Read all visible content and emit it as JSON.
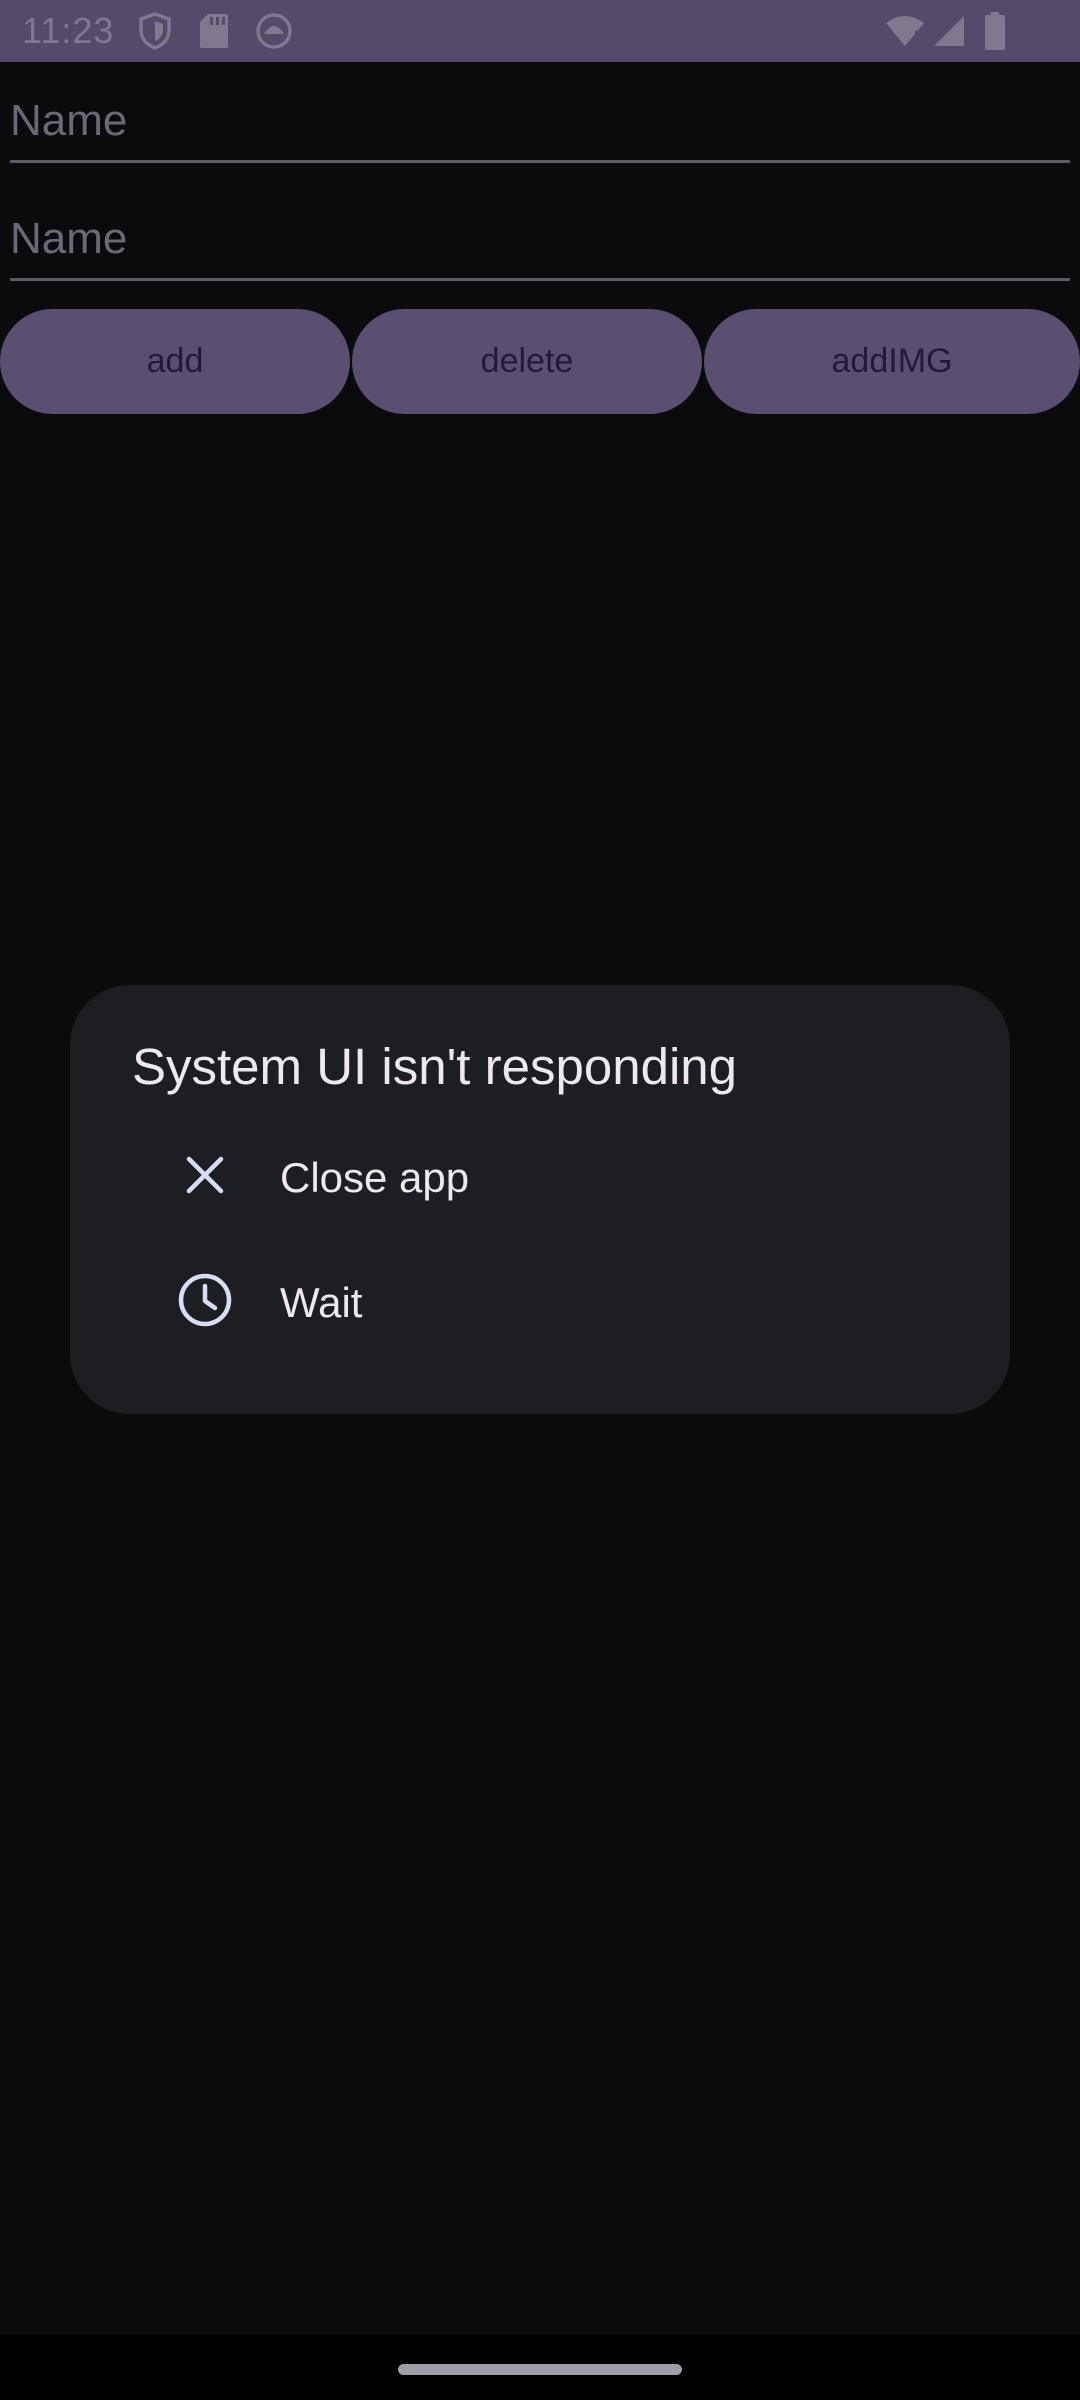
{
  "status_bar": {
    "time": "11:23",
    "icons": [
      "shield-icon",
      "sd-card-icon",
      "android-icon",
      "wifi-icon",
      "signal-icon",
      "battery-icon"
    ]
  },
  "form": {
    "field1_placeholder": "Name",
    "field2_placeholder": "Name"
  },
  "buttons": {
    "add": "add",
    "delete": "delete",
    "addimg": "addIMG"
  },
  "dialog": {
    "title": "System UI isn't responding",
    "options": [
      {
        "icon": "close-icon",
        "label": "Close app"
      },
      {
        "icon": "clock-icon",
        "label": "Wait"
      }
    ]
  },
  "colors": {
    "status_bar_bg": "#544b6b",
    "button_bg": "#5a4f70",
    "button_text": "#231a38",
    "dialog_bg": "#1d1e22",
    "background": "#0b0b0d",
    "icon_tint": "#d8dcf5"
  }
}
